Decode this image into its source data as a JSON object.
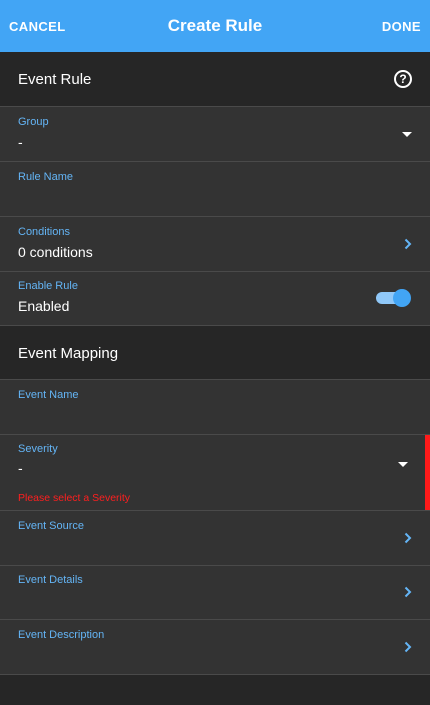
{
  "header": {
    "cancel_label": "CANCEL",
    "title": "Create Rule",
    "done_label": "DONE",
    "accent_color": "#42a5f5"
  },
  "event_rule": {
    "heading": "Event Rule",
    "help_icon": "help-circle-icon",
    "group": {
      "label": "Group",
      "value": "-"
    },
    "rule_name": {
      "label": "Rule Name",
      "value": ""
    },
    "conditions": {
      "label": "Conditions",
      "value": "0 conditions"
    },
    "enable_rule": {
      "label": "Enable Rule",
      "value": "Enabled",
      "on": true
    }
  },
  "event_mapping": {
    "heading": "Event Mapping",
    "event_name": {
      "label": "Event Name",
      "value": ""
    },
    "severity": {
      "label": "Severity",
      "value": "-",
      "error": "Please select a Severity",
      "error_color": "#ff1a1a"
    },
    "event_source": {
      "label": "Event Source"
    },
    "event_details": {
      "label": "Event Details"
    },
    "event_description": {
      "label": "Event Description"
    }
  }
}
